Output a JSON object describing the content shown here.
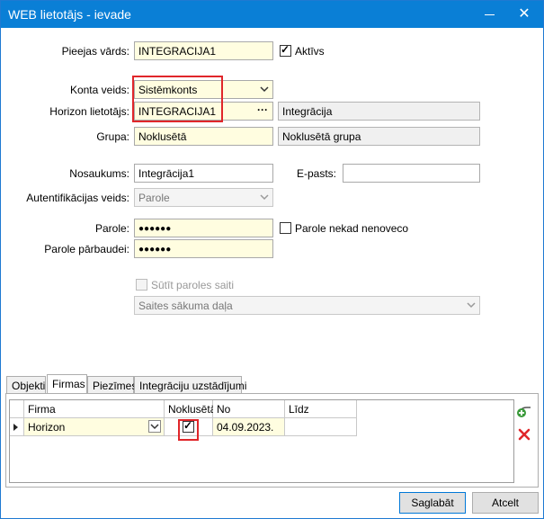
{
  "window": {
    "title": "WEB lietotājs - ievade"
  },
  "form": {
    "login_label": "Pieejas vārds:",
    "login_value": "INTEGRACIJA1",
    "active_label": "Aktīvs",
    "account_type_label": "Konta veids:",
    "account_type_value": "Sistēmkonts",
    "horizon_user_label": "Horizon lietotājs:",
    "horizon_user_value": "INTEGRACIJA1",
    "horizon_user_name": "Integrācija",
    "group_label": "Grupa:",
    "group_value": "Noklusētā",
    "group_name": "Noklusētā grupa",
    "name_label": "Nosaukums:",
    "name_value": "Integrācija1",
    "email_label": "E-pasts:",
    "email_value": "",
    "auth_label": "Autentifikācijas veids:",
    "auth_value": "Parole",
    "password_label": "Parole:",
    "password_value": "●●●●●●",
    "password_never_expires_label": "Parole nekad nenoveco",
    "password_confirm_label": "Parole pārbaudei:",
    "password_confirm_value": "●●●●●●",
    "send_password_link_label": "Sūtīt paroles saiti",
    "link_start_page_placeholder": "Saites sākuma daļa"
  },
  "tabs": [
    "Objekti",
    "Firmas",
    "Piezīmes",
    "Integrāciju uzstādījumi"
  ],
  "active_tab": "Firmas",
  "grid": {
    "columns": [
      "Firma",
      "Noklusētā",
      "No",
      "Līdz"
    ],
    "rows": [
      {
        "firma": "Horizon",
        "default": true,
        "from": "04.09.2023.",
        "to": ""
      }
    ]
  },
  "buttons": {
    "save": "Saglabāt",
    "cancel": "Atcelt"
  },
  "colors": {
    "titlebar": "#0a7fd6",
    "input_highlight": "#fffde0",
    "annotation": "#e0262a",
    "delete": "#e0262a",
    "add": "#3a9a3a"
  }
}
